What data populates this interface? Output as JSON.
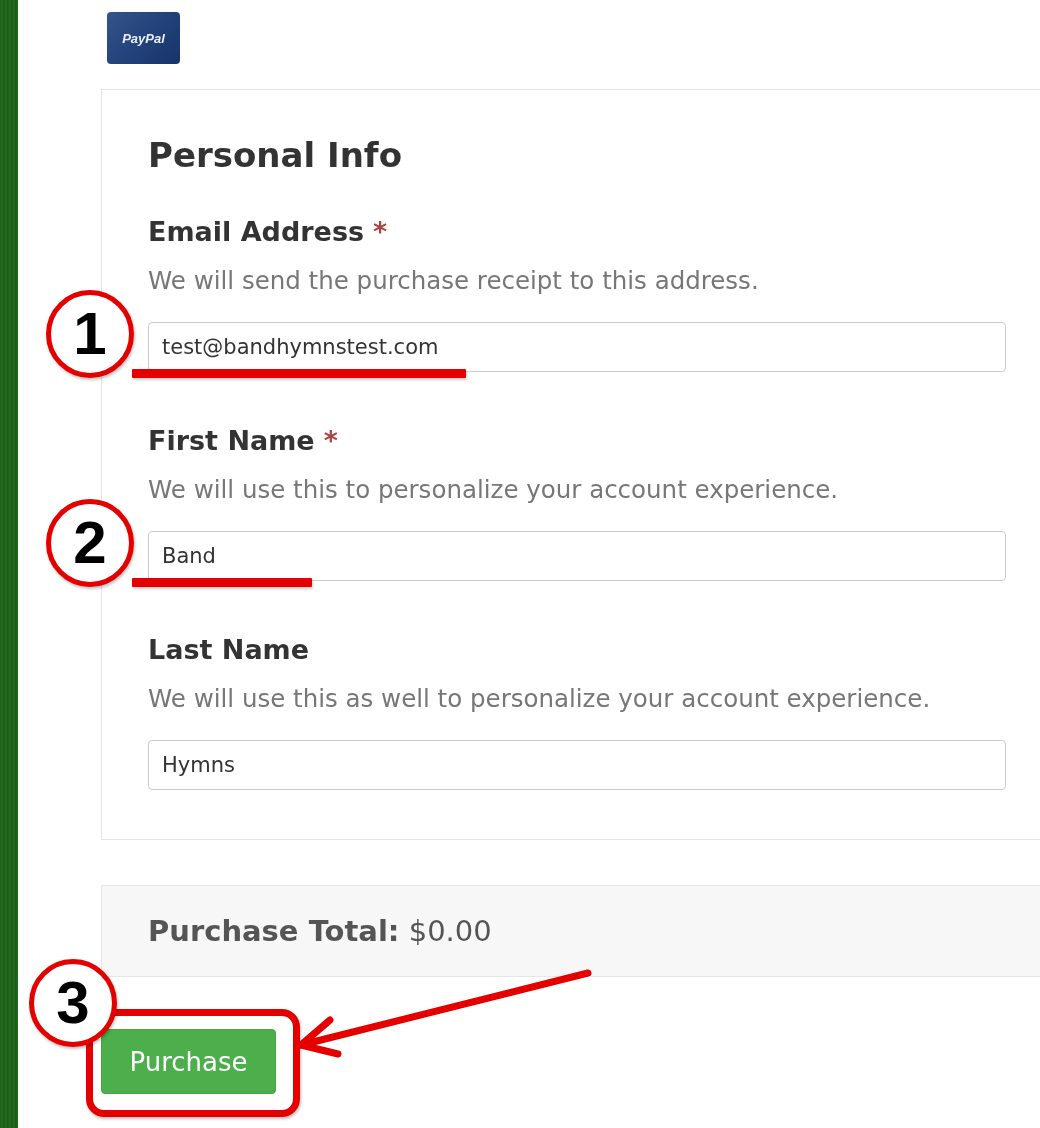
{
  "logo": {
    "text": "PayPal"
  },
  "form": {
    "title": "Personal Info",
    "fields": [
      {
        "label": "Email Address",
        "mark": "*",
        "help": "We will send the purchase receipt to this address.",
        "value": "test@bandhymnstest.com",
        "annotation": {
          "number": "1",
          "kind": "underline"
        }
      },
      {
        "label": "First Name",
        "mark": "*",
        "help": "We will use this to personalize your account experience.",
        "value": "Band",
        "annotation": {
          "number": "2",
          "kind": "underline"
        }
      },
      {
        "label": "Last Name",
        "help": "We will use this as well to personalize your account experience.",
        "value": "Hymns"
      }
    ]
  },
  "summary": {
    "text": "**Purchase Total:** $0.00"
  },
  "purchase_button": {
    "label": "Purchase",
    "annotation": {
      "number": "3",
      "kind": "frame_arrow"
    }
  }
}
